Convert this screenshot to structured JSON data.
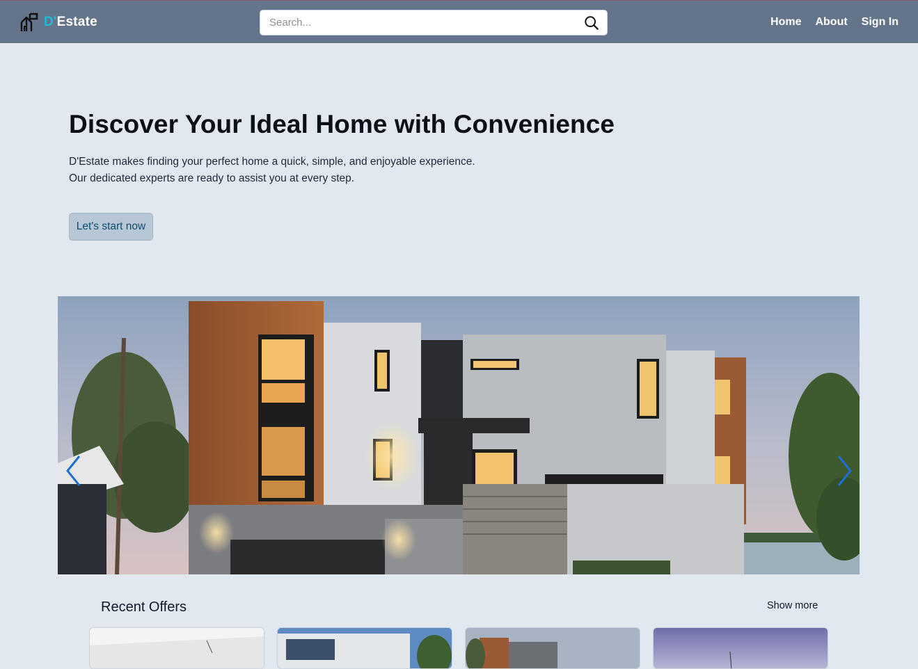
{
  "header": {
    "logo_accent": "D'",
    "logo_rest": "Estate",
    "search_placeholder": "Search...",
    "nav": [
      "Home",
      "About",
      "Sign In"
    ]
  },
  "hero": {
    "title": "Discover Your Ideal Home with Convenience",
    "subtitle_line1": "D'Estate makes finding your perfect home a quick, simple, and enjoyable experience.",
    "subtitle_line2": "Our dedicated experts are ready to assist you at every step.",
    "cta": "Let's start now"
  },
  "carousel": {
    "image_alt": "Modern house exterior at dusk",
    "prev_icon": "chevron-left-icon",
    "next_icon": "chevron-right-icon"
  },
  "recent": {
    "title": "Recent Offers",
    "show_more": "Show more"
  },
  "colors": {
    "header_bg": "#64748b",
    "page_bg": "#e2e8f0",
    "logo_accent": "#22b8d8",
    "cta_bg": "#b8c7d5",
    "arrow": "#1d6fd1"
  }
}
